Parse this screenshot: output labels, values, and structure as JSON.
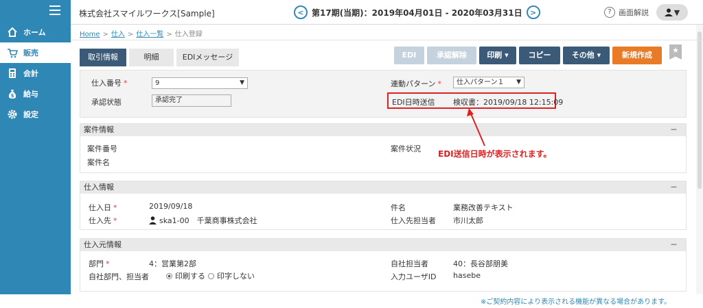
{
  "sidebar": {
    "items": [
      {
        "label": "ホーム",
        "icon": "home-icon"
      },
      {
        "label": "販売",
        "icon": "cart-icon"
      },
      {
        "label": "会計",
        "icon": "calculator-icon"
      },
      {
        "label": "給与",
        "icon": "money-bag-icon"
      },
      {
        "label": "設定",
        "icon": "gear-icon"
      }
    ],
    "active_item": "販売"
  },
  "header": {
    "company": "株式会社スマイルワークス[Sample]",
    "period": "第17期(当期)：2019年04月01日 - 2020年03月31日",
    "help_label": "画面解説",
    "user_caret": "▼"
  },
  "breadcrumb": {
    "items": [
      "Home",
      "仕入",
      "仕入一覧",
      "仕入登録"
    ],
    "separator": ">"
  },
  "tabs": [
    "取引情報",
    "明細",
    "EDIメッセージ"
  ],
  "actions": {
    "edi": "EDI",
    "unapprove": "承認解除",
    "print": "印刷 ▾",
    "copy": "コピー",
    "other": "その他 ▾",
    "new": "新規作成"
  },
  "top_panel": {
    "purchase_no_label": "仕入番号",
    "purchase_no_value": "9",
    "approval_label": "承認状態",
    "approval_value": "承認完了",
    "link_pattern_label": "連動パターン",
    "link_pattern_value": "仕入パターン１",
    "edi_sent_label": "EDI日時送信",
    "edi_sent_value": "検収書：2019/09/18 12:15:09"
  },
  "annotation": "EDI送信日時が表示されます。",
  "case_section": {
    "title": "案件情報",
    "case_no_label": "案件番号",
    "case_name_label": "案件名",
    "case_status_label": "案件状況"
  },
  "purchase_section": {
    "title": "仕入情報",
    "date_label": "仕入日",
    "date_value": "2019/09/18",
    "supplier_label": "仕入先",
    "supplier_value": "ska1-00　千葉商事株式会社",
    "subject_label": "件名",
    "subject_value": "業務改善テキスト",
    "contact_label": "仕入先担当者",
    "contact_value": "市川太郎"
  },
  "origin_section": {
    "title": "仕入元情報",
    "dept_label": "部門",
    "dept_value": "4：営業第2部",
    "self_dept_label": "自社部門、担当者",
    "print_yes": "印刷する",
    "print_no": "印字しない",
    "staff_label": "自社担当者",
    "staff_value": "40：長谷部朋美",
    "input_user_label": "入力ユーザID",
    "input_user_value": "hasebe"
  },
  "collapse_symbol": "－",
  "required_mark": "*",
  "footnote": "※ご契約内容により表示される機能が異なる場合があります。",
  "colors": {
    "sidebar": "#2f87b5",
    "tab_active": "#3a5a78",
    "new_button": "#e97a26",
    "highlight": "#e02020"
  }
}
